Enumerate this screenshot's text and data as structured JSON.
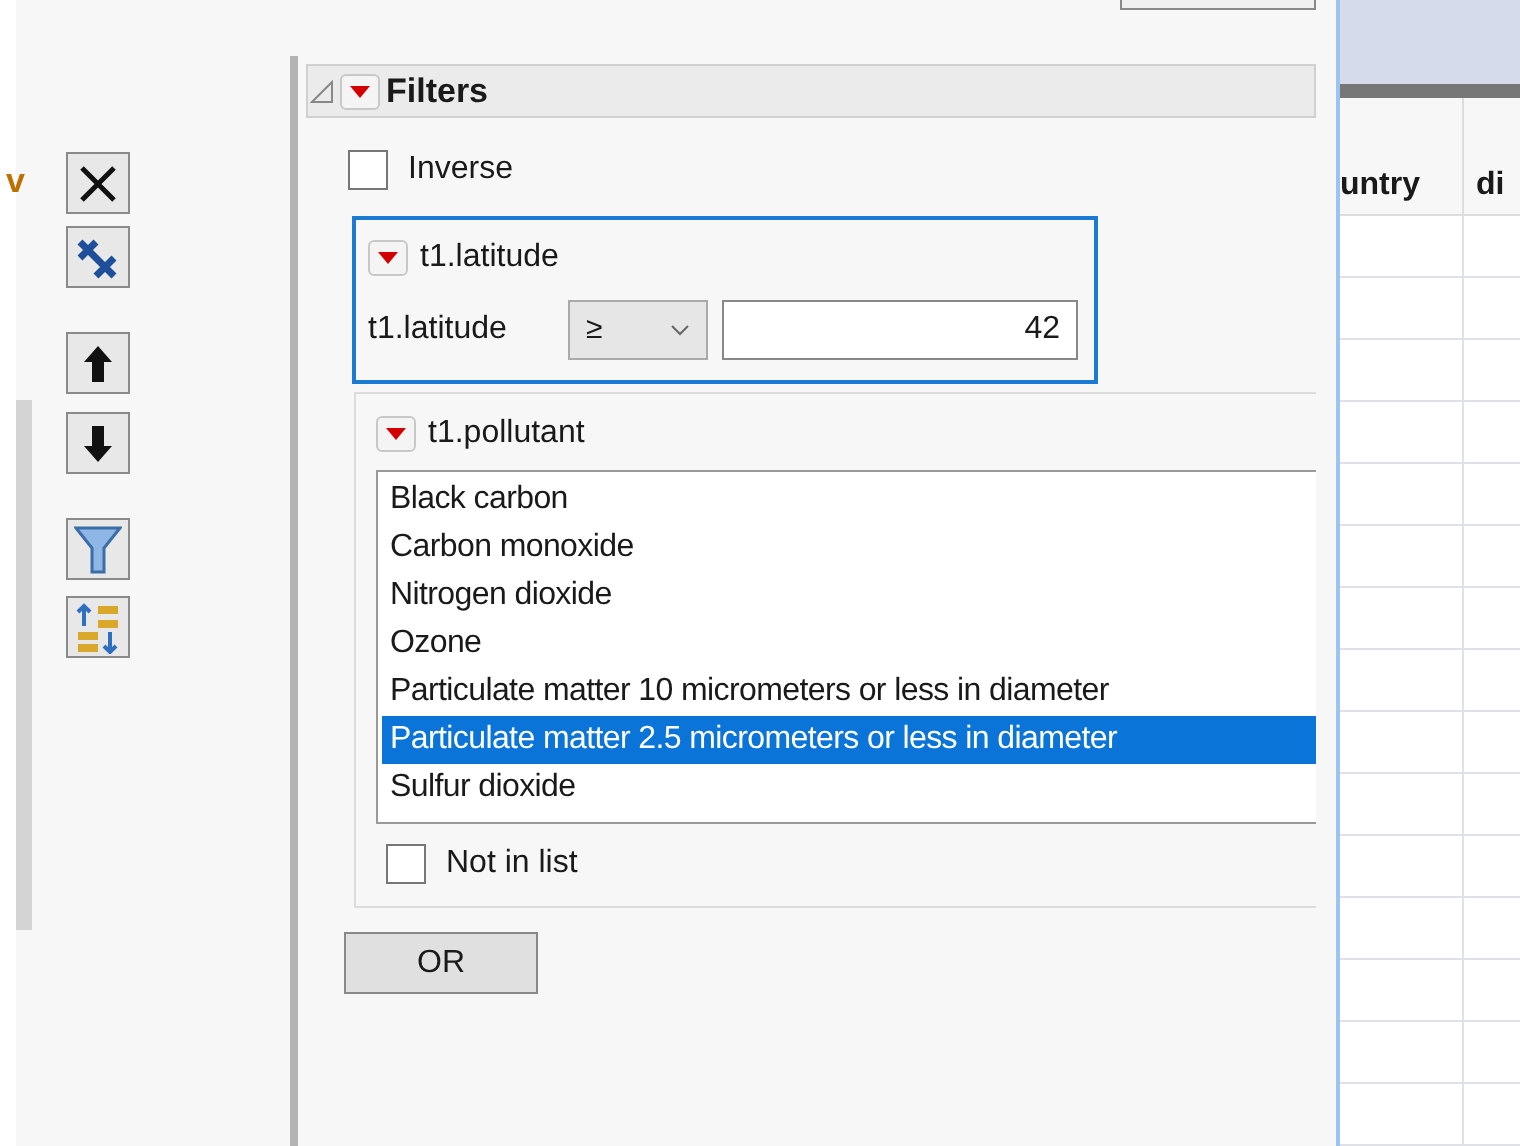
{
  "left_panel": {
    "cut_label": "v"
  },
  "filters": {
    "title": "Filters",
    "expanded": true,
    "inverse": {
      "label": "Inverse",
      "checked": false
    },
    "latitude": {
      "title": "t1.latitude",
      "label": "t1.latitude",
      "operator": "≥",
      "value": "42",
      "focused": true
    },
    "pollutant": {
      "title": "t1.pollutant",
      "items": [
        {
          "label": "Black carbon",
          "selected": false
        },
        {
          "label": "Carbon monoxide",
          "selected": false
        },
        {
          "label": "Nitrogen dioxide",
          "selected": false
        },
        {
          "label": "Ozone",
          "selected": false
        },
        {
          "label": "Particulate matter 10 micrometers or less in diameter",
          "selected": false
        },
        {
          "label": "Particulate matter 2.5 micrometers or less in diameter",
          "selected": true
        },
        {
          "label": "Sulfur dioxide",
          "selected": false
        }
      ],
      "not_in_list": {
        "label": "Not in list",
        "checked": false
      }
    },
    "or_button": "OR"
  },
  "table": {
    "columns": [
      "untry",
      "di"
    ]
  }
}
